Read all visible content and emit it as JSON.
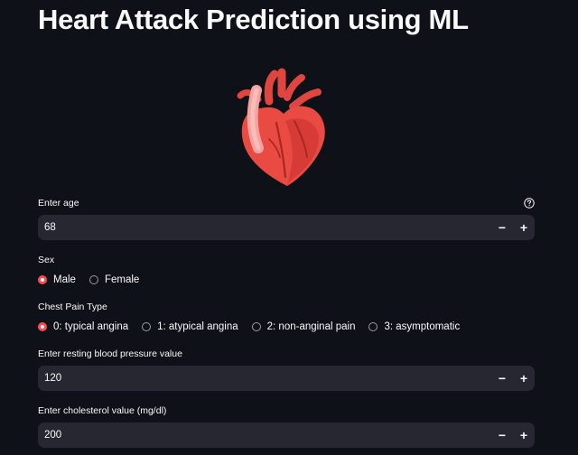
{
  "page": {
    "title": "Heart Attack Prediction using ML",
    "hero_icon": "anatomical-heart-icon"
  },
  "theme": {
    "background": "#0e1117",
    "input_background": "#262730",
    "accent": "#ff4b4b",
    "text": "#fafafa"
  },
  "age": {
    "label": "Enter age",
    "value": "68",
    "minus": "−",
    "plus": "+"
  },
  "sex": {
    "label": "Sex",
    "options": [
      "Male",
      "Female"
    ],
    "selected": "Male"
  },
  "chest_pain": {
    "label": "Chest Pain Type",
    "options": [
      "0: typical angina",
      "1: atypical angina",
      "2: non-anginal pain",
      "3: asymptomatic"
    ],
    "selected": "0: typical angina"
  },
  "resting_bp": {
    "label": "Enter resting blood pressure value",
    "value": "120",
    "minus": "−",
    "plus": "+"
  },
  "cholesterol": {
    "label": "Enter cholesterol value (mg/dl)",
    "value": "200",
    "minus": "−",
    "plus": "+"
  }
}
